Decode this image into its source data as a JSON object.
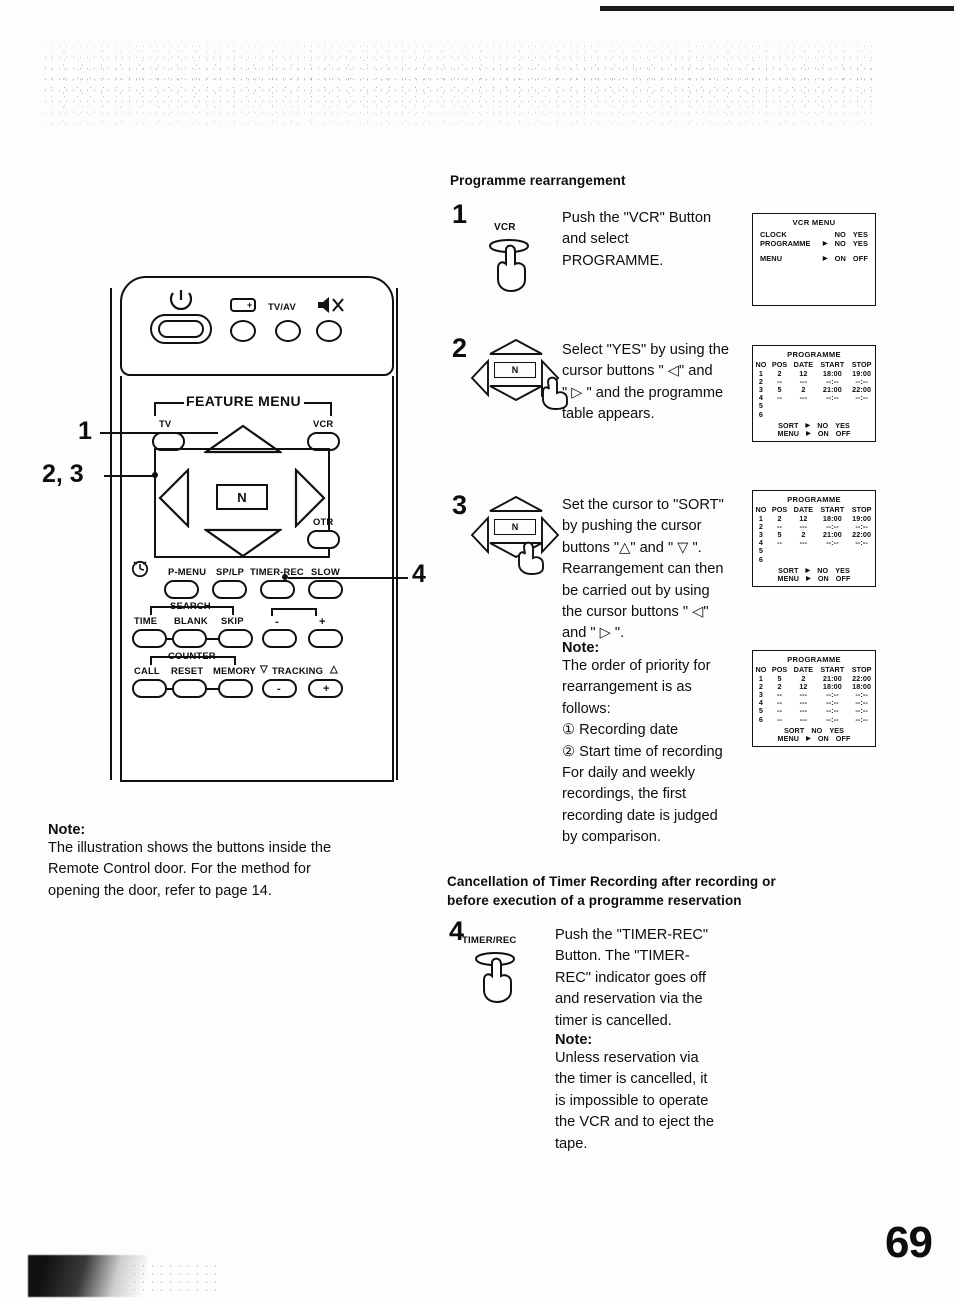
{
  "page": {
    "number": "69"
  },
  "remote": {
    "top_row": {
      "power_icon": "power-icon",
      "plus_label": "+",
      "tvav_label": "TV/AV",
      "mute_icon": "mute-icon"
    },
    "feature_menu_label": "FEATURE MENU",
    "tv_label": "TV",
    "vcr_label": "VCR",
    "cursor_center_label": "N",
    "otr_label": "OTR",
    "row_menu": [
      "P-MENU",
      "SP/LP",
      "TIMER-REC",
      "SLOW"
    ],
    "search_group_label": "SEARCH",
    "row_search": [
      "TIME",
      "BLANK",
      "SKIP"
    ],
    "counter_group_label": "COUNTER",
    "row_counter": [
      "CALL",
      "RESET",
      "MEMORY"
    ],
    "tracking_label": "TRACKING",
    "tracking_minus": "-",
    "tracking_plus": "+",
    "volume_minus": "-",
    "volume_plus": "+",
    "clock_icon": "clock-icon",
    "callouts": {
      "one": "1",
      "two_three": "2, 3",
      "four": "4"
    }
  },
  "left_note": {
    "label": "Note:",
    "lines": [
      "The illustration shows the buttons inside the",
      "Remote Control door. For the method for",
      "opening the door, refer to page 14."
    ]
  },
  "section": {
    "heading": "Programme rearrangement"
  },
  "steps": [
    {
      "number": "1",
      "button_label": "VCR",
      "text_lines": [
        "Push the \"VCR\" Button",
        "and select",
        "PROGRAMME."
      ]
    },
    {
      "number": "2",
      "pad_label": "N",
      "text_lines": [
        "Select \"YES\" by using the",
        "cursor buttons \" ◁\" and",
        "\" ▷ \" and the programme",
        "table appears."
      ]
    },
    {
      "number": "3",
      "pad_label": "N",
      "text_lines": [
        "Set the cursor to \"SORT\"",
        "by pushing the cursor",
        "buttons \"△\" and \" ▽ \".",
        "Rearrangement can then",
        "be carried out by using",
        "the cursor buttons \" ◁\"",
        "and \" ▷ \"."
      ]
    }
  ],
  "step3_note": {
    "label": "Note:",
    "lines": [
      "The order of priority for",
      "rearrangement is as",
      "follows:",
      "①  Recording date",
      "②  Start time of recording",
      "For daily and weekly",
      "recordings, the first",
      "recording date is judged",
      "by comparison."
    ]
  },
  "cancellation": {
    "heading_lines": [
      "Cancellation of Timer Recording after recording or",
      "before execution of a programme reservation"
    ],
    "step": {
      "number": "4",
      "button_label": "TIMER/REC",
      "text_lines": [
        "Push the \"TIMER-REC\"",
        "Button. The \"TIMER-",
        "REC\" indicator goes off",
        "and reservation via the",
        "timer is cancelled."
      ]
    },
    "note": {
      "label": "Note:",
      "lines": [
        "Unless reservation via",
        "the timer is cancelled, it",
        "is impossible to operate",
        "the VCR and to eject the",
        "tape."
      ]
    }
  },
  "osd_screens": [
    {
      "id": "vcr-menu",
      "title": "VCR MENU",
      "rows": [
        {
          "label": "CLOCK",
          "cursor": "",
          "options": [
            "NO",
            "YES"
          ]
        },
        {
          "label": "PROGRAMME",
          "cursor": "▶",
          "options": [
            "NO",
            "YES"
          ]
        }
      ],
      "menu_label": "MENU",
      "menu_cursor": "▶",
      "menu_options": [
        "ON",
        "OFF"
      ]
    },
    {
      "id": "programme-table-1",
      "title": "PROGRAMME",
      "headers": [
        "NO",
        "POS",
        "DATE",
        "START",
        "STOP"
      ],
      "rows": [
        [
          "1",
          "2",
          "12",
          "18:00",
          "19:00"
        ],
        [
          "2",
          "--",
          "---",
          "--:--",
          "--:--"
        ],
        [
          "3",
          "5",
          "2",
          "21:00",
          "22:00"
        ],
        [
          "4",
          "--",
          "---",
          "--:--",
          "--:--"
        ],
        [
          "5",
          "",
          "",
          "",
          ""
        ],
        [
          "6",
          "",
          "",
          "",
          ""
        ]
      ],
      "sort_label": "SORT",
      "sort_cursor": "▶",
      "sort_options": [
        "NO",
        "YES"
      ],
      "menu_label": "MENU",
      "menu_cursor": "▶",
      "menu_options": [
        "ON",
        "OFF"
      ]
    },
    {
      "id": "programme-table-2",
      "title": "PROGRAMME",
      "headers": [
        "NO",
        "POS",
        "DATE",
        "START",
        "STOP"
      ],
      "rows": [
        [
          "1",
          "2",
          "12",
          "18:00",
          "19:00"
        ],
        [
          "2",
          "--",
          "---",
          "--:--",
          "--:--"
        ],
        [
          "3",
          "5",
          "2",
          "21:00",
          "22:00"
        ],
        [
          "4",
          "--",
          "---",
          "--:--",
          "--:--"
        ],
        [
          "5",
          "",
          "",
          "",
          ""
        ],
        [
          "6",
          "",
          "",
          "",
          ""
        ]
      ],
      "sort_label": "SORT",
      "sort_cursor": "▶",
      "sort_options": [
        "NO",
        "YES"
      ],
      "menu_label": "MENU",
      "menu_cursor": "▶",
      "menu_options": [
        "ON",
        "OFF"
      ]
    },
    {
      "id": "programme-table-sorted",
      "title": "PROGRAMME",
      "headers": [
        "NO",
        "POS",
        "DATE",
        "START",
        "STOP"
      ],
      "rows": [
        [
          "1",
          "5",
          "2",
          "21:00",
          "22:00"
        ],
        [
          "2",
          "2",
          "12",
          "18:00",
          "18:00"
        ],
        [
          "3",
          "--",
          "---",
          "--:--",
          "--:--"
        ],
        [
          "4",
          "--",
          "---",
          "--:--",
          "--:--"
        ],
        [
          "5",
          "--",
          "---",
          "--:--",
          "--:--"
        ],
        [
          "6",
          "--",
          "---",
          "--:--",
          "--:--"
        ]
      ],
      "sort_label": "SORT",
      "sort_cursor": "▶",
      "sort_options": [
        "NO",
        "YES"
      ],
      "menu_label": "MENU",
      "menu_cursor": "▶",
      "menu_options": [
        "ON",
        "OFF"
      ]
    }
  ]
}
